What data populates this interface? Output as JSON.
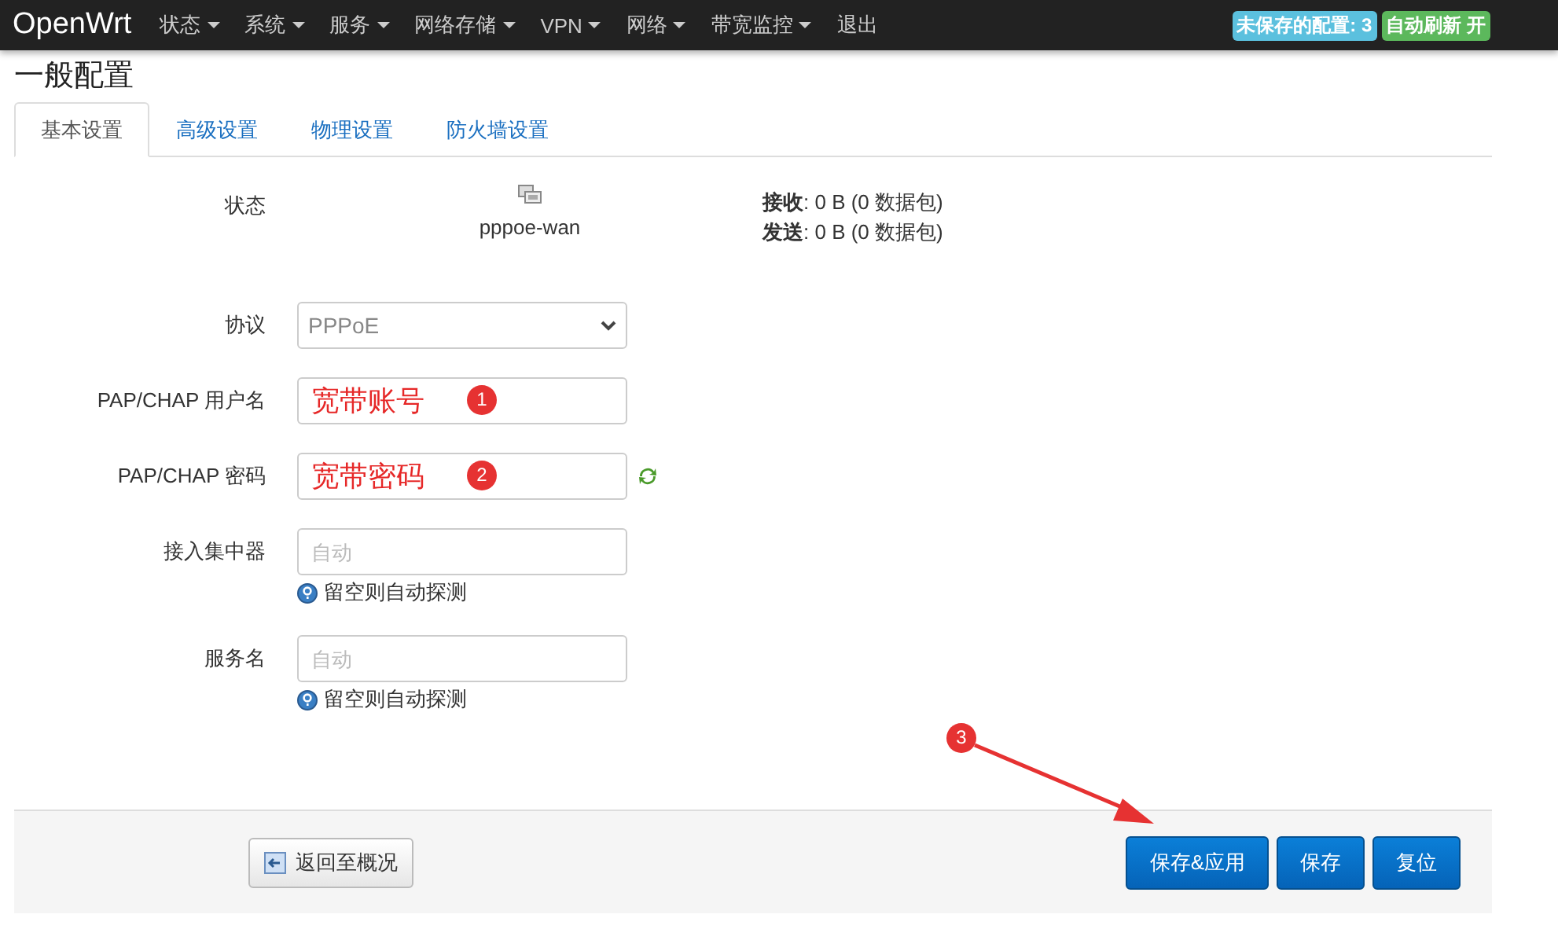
{
  "navbar": {
    "brand": "OpenWrt",
    "menus": [
      {
        "label": "状态",
        "dropdown": true
      },
      {
        "label": "系统",
        "dropdown": true
      },
      {
        "label": "服务",
        "dropdown": true
      },
      {
        "label": "网络存储",
        "dropdown": true
      },
      {
        "label": "VPN",
        "dropdown": true
      },
      {
        "label": "网络",
        "dropdown": true
      },
      {
        "label": "带宽监控",
        "dropdown": true
      },
      {
        "label": "退出",
        "dropdown": false
      }
    ],
    "badges": [
      {
        "text": "未保存的配置: 3",
        "color": "#5bc0de"
      },
      {
        "text": "自动刷新 开",
        "color": "#5cb85c"
      }
    ]
  },
  "page_title": "一般配置",
  "tabs": [
    {
      "label": "基本设置",
      "selected": true
    },
    {
      "label": "高级设置",
      "selected": false
    },
    {
      "label": "物理设置",
      "selected": false
    },
    {
      "label": "防火墙设置",
      "selected": false
    }
  ],
  "status": {
    "label": "状态",
    "interface": "pppoe-wan",
    "rx_label": "接收",
    "rx_value": ": 0 B (0 数据包)",
    "tx_label": "发送",
    "tx_value": ": 0 B (0 数据包)"
  },
  "fields": [
    {
      "label": "协议",
      "kind": "select",
      "value": "PPPoE"
    },
    {
      "label": "PAP/CHAP 用户名",
      "kind": "text",
      "value": "宽带账号",
      "marker": "1"
    },
    {
      "label": "PAP/CHAP 密码",
      "kind": "password",
      "value": "宽带密码",
      "marker": "2"
    },
    {
      "label": "接入集中器",
      "kind": "text",
      "placeholder": "自动",
      "help": "留空则自动探测"
    },
    {
      "label": "服务名",
      "kind": "text",
      "placeholder": "自动",
      "help": "留空则自动探测"
    }
  ],
  "footer": {
    "back_button": "返回至概况",
    "marker": "3",
    "buttons": [
      "保存&应用",
      "保存",
      "复位"
    ]
  }
}
